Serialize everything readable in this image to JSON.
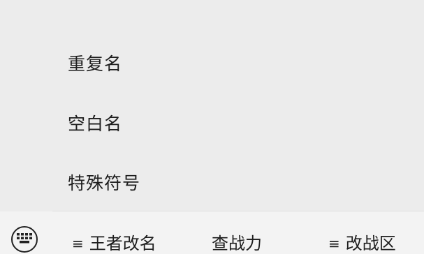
{
  "popup_menu": {
    "items": [
      {
        "label": "重复名"
      },
      {
        "label": "空白名"
      },
      {
        "label": "特殊符号"
      }
    ]
  },
  "bottom_bar": {
    "keyboard_icon": "keyboard-icon",
    "menu_lines_icon": "≡",
    "menus": [
      {
        "label": "王者改名",
        "has_submenu": true
      },
      {
        "label": "查战力",
        "has_submenu": false
      },
      {
        "label": "改战区",
        "has_submenu": true
      }
    ]
  }
}
